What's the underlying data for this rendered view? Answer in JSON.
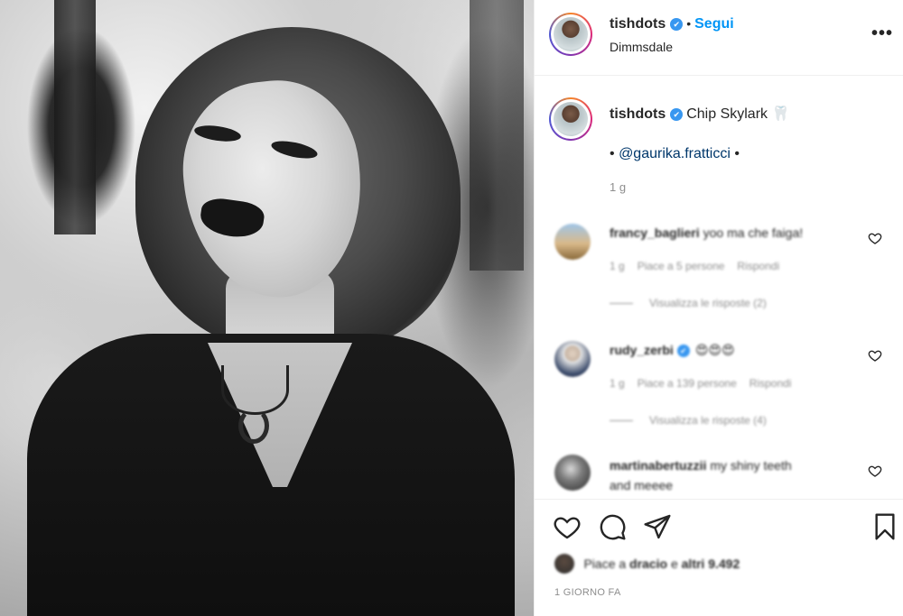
{
  "header": {
    "username": "tishdots",
    "verified_icon": "verified-badge-icon",
    "separator": "•",
    "follow_label": "Segui",
    "location": "Dimmsdale",
    "more_label": "•••"
  },
  "caption": {
    "username": "tishdots",
    "text": "Chip Skylark 🦷",
    "mention_prefix": "•",
    "mention": "@gaurika.fratticci",
    "mention_suffix": "•",
    "time": "1 g"
  },
  "comments": [
    {
      "username": "francy_baglieri",
      "text": "yoo ma che faiga!",
      "time": "1 g",
      "likes": "Piace a 5 persone",
      "reply_label": "Rispondi",
      "view_replies": "Visualizza le risposte (2)"
    },
    {
      "username": "rudy_zerbi",
      "text": "😍😍😍",
      "time": "1 g",
      "likes": "Piace a 139 persone",
      "reply_label": "Rispondi",
      "view_replies": "Visualizza le risposte (4)"
    },
    {
      "username": "martinabertuzzii",
      "text_line1": "my shiny teeth",
      "text_line2": "and meeee"
    }
  ],
  "likes": {
    "prefix": "Piace a",
    "liker": "dracio",
    "middle": "e",
    "others": "altri 9.492"
  },
  "time_ago": "1 GIORNO FA",
  "colors": {
    "accent_blue": "#0095f6",
    "verified_blue": "#3897f0",
    "text": "#262626",
    "muted": "#8e8e8e"
  }
}
